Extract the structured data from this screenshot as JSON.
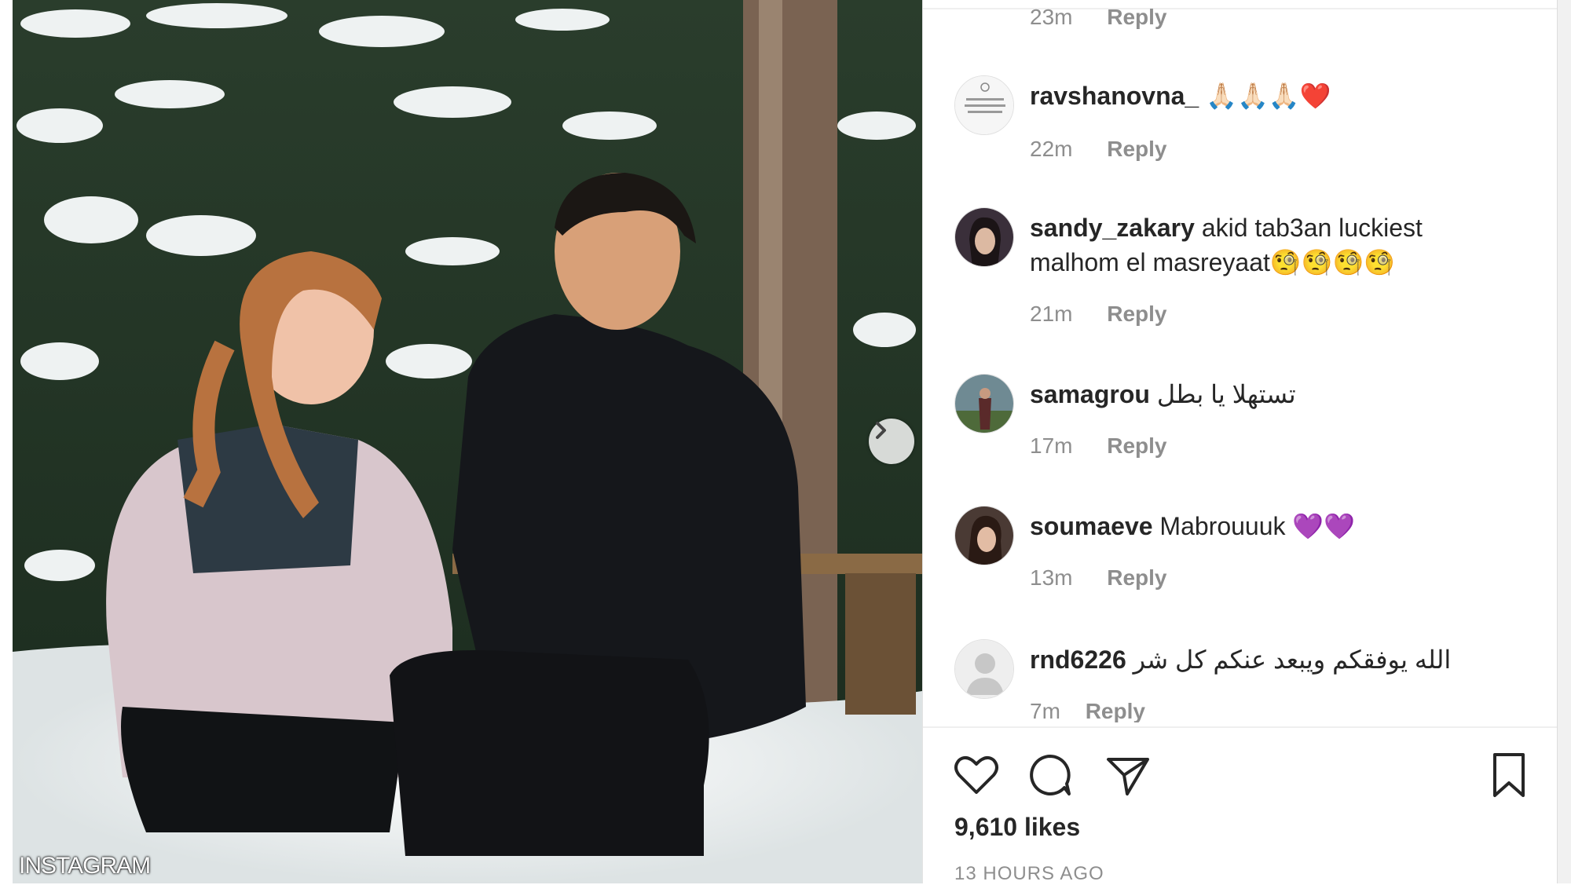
{
  "watermark": "INSTAGRAM",
  "comments": [
    {
      "username": "",
      "text": "",
      "time": "23m",
      "reply": "Reply"
    },
    {
      "username": "ravshanovna_",
      "text": "🙏🏻🙏🏻🙏🏻❤️",
      "time": "22m",
      "reply": "Reply"
    },
    {
      "username": "sandy_zakary",
      "text": "akid tab3an luckiest malhom el masreyaat🧐🧐🧐🧐",
      "time": "21m",
      "reply": "Reply"
    },
    {
      "username": "samagrou",
      "text": "تستهلا يا بطل",
      "time": "17m",
      "reply": "Reply"
    },
    {
      "username": "soumaeve",
      "text": "Mabrouuuk 💜💜",
      "time": "13m",
      "reply": "Reply"
    },
    {
      "username": "rnd6226",
      "text": "الله يوفقكم ويبعد عنكم كل شر",
      "time": "7m",
      "reply": "Reply"
    }
  ],
  "actions": {
    "icons": [
      "heart-icon",
      "comment-icon",
      "share-icon",
      "bookmark-icon"
    ]
  },
  "likes": "9,610 likes",
  "timestamp": "13 HOURS AGO",
  "colors": {
    "text": "#262626",
    "muted": "#8e8e8e",
    "border": "#efefef"
  }
}
